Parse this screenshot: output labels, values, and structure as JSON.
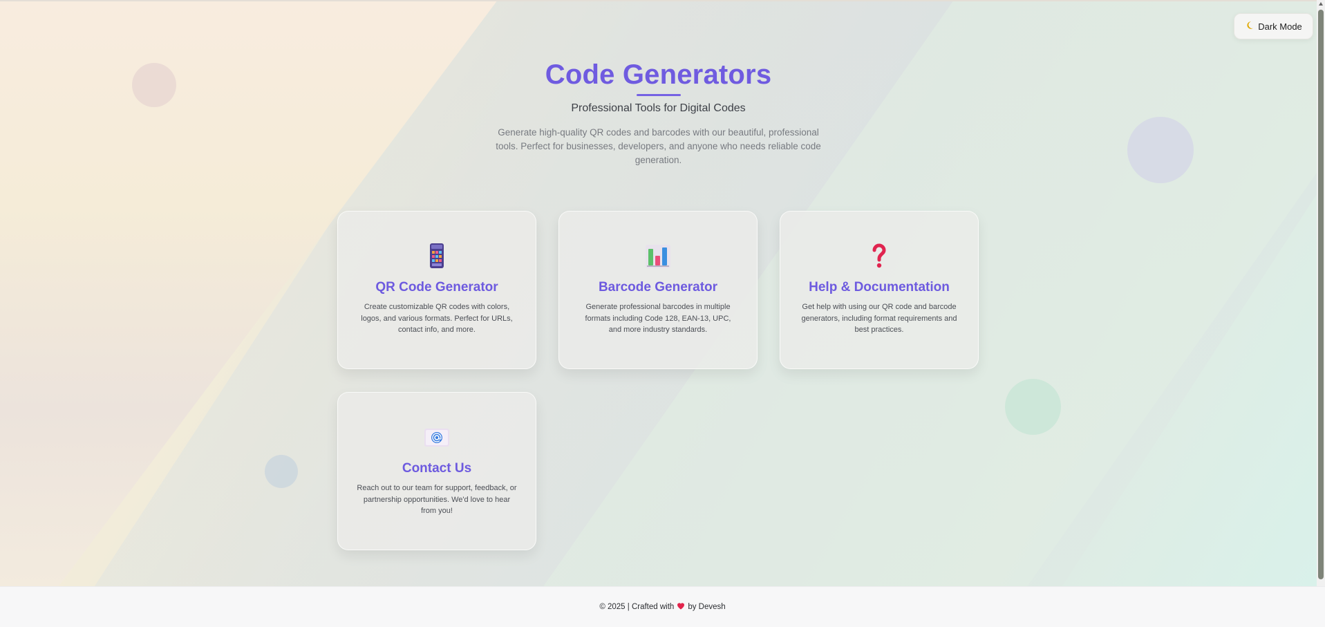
{
  "toggle": {
    "icon": "moon-icon",
    "label": "Dark Mode"
  },
  "hero": {
    "title": "Code Generators",
    "subtitle": "Professional Tools for Digital Codes",
    "description": "Generate high-quality QR codes and barcodes with our beautiful, professional tools. Perfect for businesses, developers, and anyone who needs reliable code generation."
  },
  "cards": [
    {
      "icon": "calculator-icon",
      "title": "QR Code Generator",
      "description": "Create customizable QR codes with colors, logos, and various formats. Perfect for URLs, contact info, and more."
    },
    {
      "icon": "bar-chart-icon",
      "title": "Barcode Generator",
      "description": "Generate professional barcodes in multiple formats including Code 128, EAN-13, UPC, and more industry standards."
    },
    {
      "icon": "question-mark-icon",
      "title": "Help & Documentation",
      "description": "Get help with using our QR code and barcode generators, including format requirements and best practices."
    },
    {
      "icon": "email-icon",
      "title": "Contact Us",
      "description": "Reach out to our team for support, feedback, or partnership opportunities. We'd love to hear from you!"
    }
  ],
  "footer": {
    "prefix": "© 2025 | Crafted with",
    "heart_icon": "heart-icon",
    "suffix": "by Devesh"
  },
  "colors": {
    "accent": "#6f5be0",
    "heart": "#e2244c"
  }
}
